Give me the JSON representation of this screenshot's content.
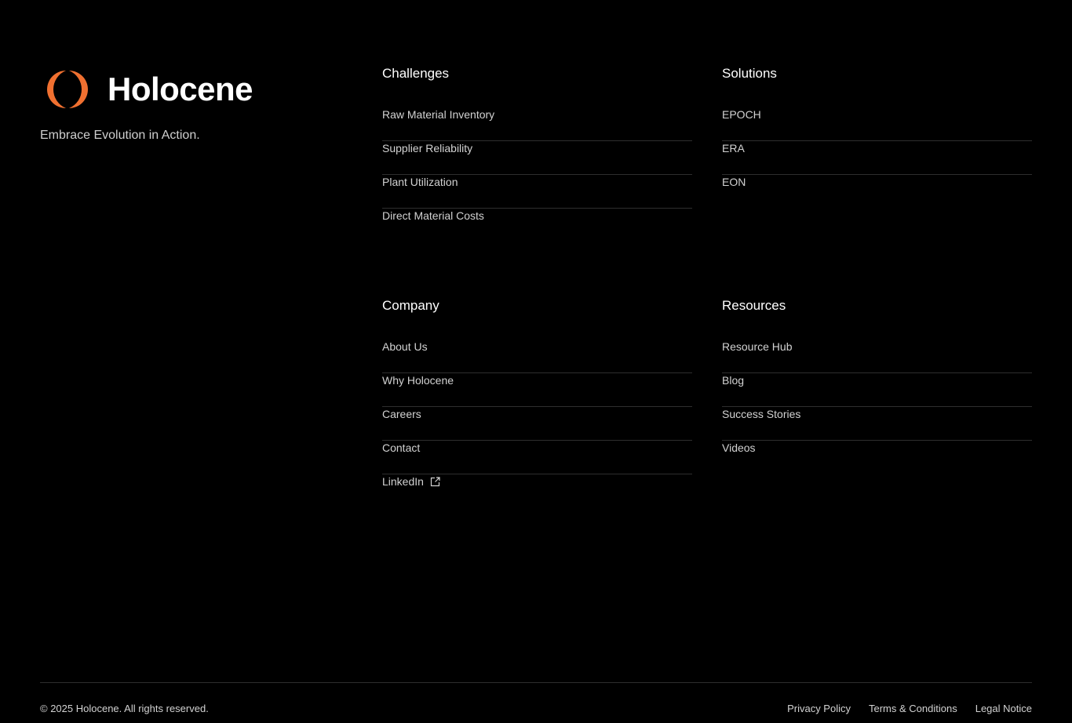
{
  "brand": {
    "name": "Holocene",
    "tagline": "Embrace Evolution in Action.",
    "logo_icon": "holocene-logo-icon",
    "accent_color": "#f07030"
  },
  "columns": {
    "challenges": {
      "title": "Challenges",
      "items": [
        "Raw Material Inventory",
        "Supplier Reliability",
        "Plant Utilization",
        "Direct Material Costs"
      ]
    },
    "solutions": {
      "title": "Solutions",
      "items": [
        "EPOCH",
        "ERA",
        "EON"
      ]
    },
    "company": {
      "title": "Company",
      "items": [
        "About Us",
        "Why Holocene",
        "Careers",
        "Contact",
        "LinkedIn"
      ],
      "external_icon": "external-link-icon"
    },
    "resources": {
      "title": "Resources",
      "items": [
        "Resource Hub",
        "Blog",
        "Success Stories",
        "Videos"
      ]
    }
  },
  "footer": {
    "copyright": "© 2025 Holocene. All rights reserved.",
    "links": [
      "Privacy Policy",
      "Terms & Conditions",
      "Legal Notice"
    ]
  }
}
